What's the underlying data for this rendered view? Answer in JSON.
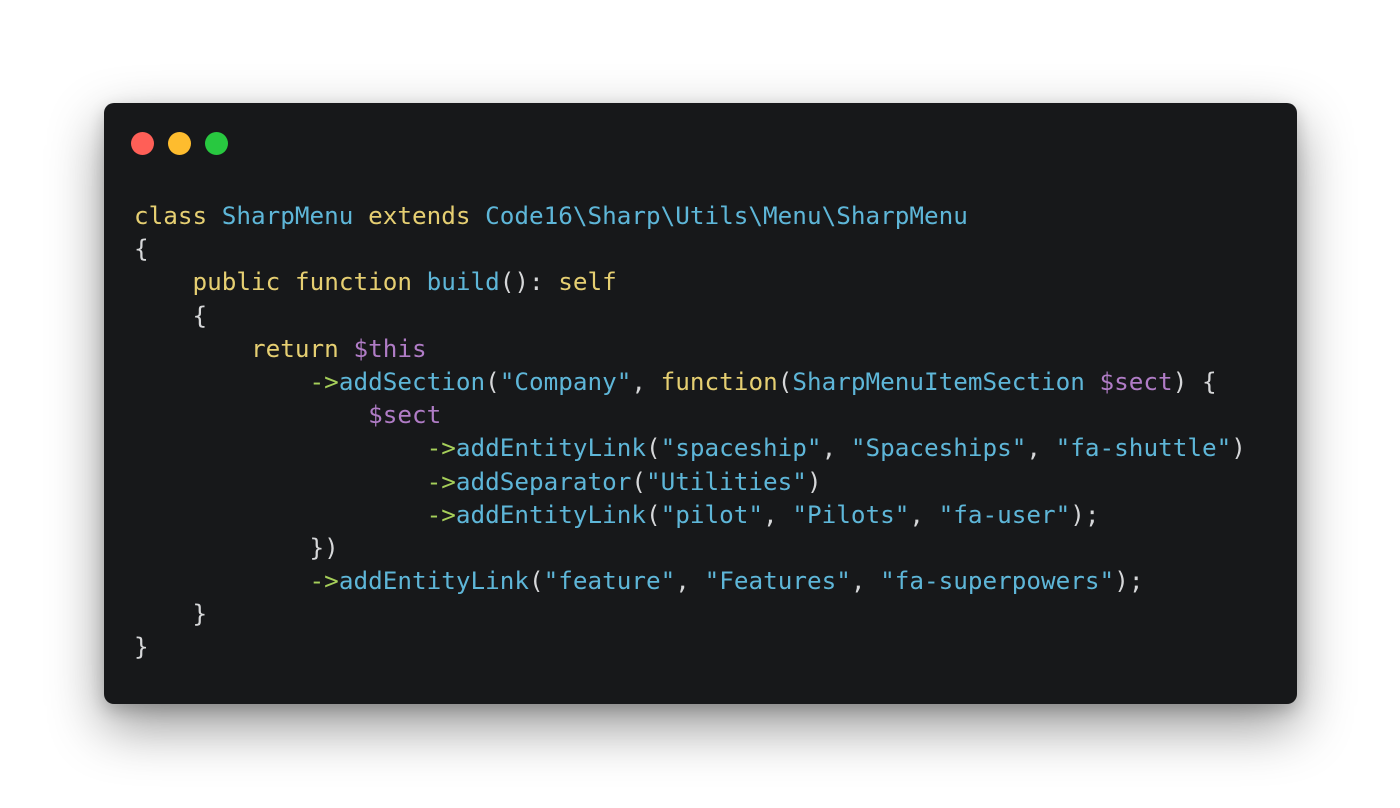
{
  "window": {
    "controls": [
      {
        "name": "close",
        "color": "#ff5f57"
      },
      {
        "name": "minimize",
        "color": "#febc2e"
      },
      {
        "name": "maximize",
        "color": "#28c840"
      }
    ]
  },
  "code": {
    "lines": [
      [
        {
          "t": "keyword",
          "v": "class"
        },
        {
          "t": "plain",
          "v": " "
        },
        {
          "t": "class",
          "v": "SharpMenu"
        },
        {
          "t": "plain",
          "v": " "
        },
        {
          "t": "keyword",
          "v": "extends"
        },
        {
          "t": "plain",
          "v": " "
        },
        {
          "t": "class",
          "v": "Code16\\Sharp\\Utils\\Menu\\SharpMenu"
        }
      ],
      [
        {
          "t": "punct",
          "v": "{"
        }
      ],
      [
        {
          "t": "plain",
          "v": "    "
        },
        {
          "t": "keyword",
          "v": "public"
        },
        {
          "t": "plain",
          "v": " "
        },
        {
          "t": "keyword",
          "v": "function"
        },
        {
          "t": "plain",
          "v": " "
        },
        {
          "t": "func",
          "v": "build"
        },
        {
          "t": "punct",
          "v": "():"
        },
        {
          "t": "plain",
          "v": " "
        },
        {
          "t": "keyword",
          "v": "self"
        }
      ],
      [
        {
          "t": "plain",
          "v": "    "
        },
        {
          "t": "punct",
          "v": "{"
        }
      ],
      [
        {
          "t": "plain",
          "v": "        "
        },
        {
          "t": "keyword",
          "v": "return"
        },
        {
          "t": "plain",
          "v": " "
        },
        {
          "t": "var",
          "v": "$this"
        }
      ],
      [
        {
          "t": "plain",
          "v": "            "
        },
        {
          "t": "arrow",
          "v": "->"
        },
        {
          "t": "func",
          "v": "addSection"
        },
        {
          "t": "punct",
          "v": "("
        },
        {
          "t": "string",
          "v": "\"Company\""
        },
        {
          "t": "punct",
          "v": ","
        },
        {
          "t": "plain",
          "v": " "
        },
        {
          "t": "keyword",
          "v": "function"
        },
        {
          "t": "punct",
          "v": "("
        },
        {
          "t": "class",
          "v": "SharpMenuItemSection"
        },
        {
          "t": "plain",
          "v": " "
        },
        {
          "t": "var",
          "v": "$sect"
        },
        {
          "t": "punct",
          "v": ")"
        },
        {
          "t": "plain",
          "v": " "
        },
        {
          "t": "punct",
          "v": "{"
        }
      ],
      [
        {
          "t": "plain",
          "v": "                "
        },
        {
          "t": "var",
          "v": "$sect"
        }
      ],
      [
        {
          "t": "plain",
          "v": "                    "
        },
        {
          "t": "arrow",
          "v": "->"
        },
        {
          "t": "func",
          "v": "addEntityLink"
        },
        {
          "t": "punct",
          "v": "("
        },
        {
          "t": "string",
          "v": "\"spaceship\""
        },
        {
          "t": "punct",
          "v": ","
        },
        {
          "t": "plain",
          "v": " "
        },
        {
          "t": "string",
          "v": "\"Spaceships\""
        },
        {
          "t": "punct",
          "v": ","
        },
        {
          "t": "plain",
          "v": " "
        },
        {
          "t": "string",
          "v": "\"fa-shuttle\""
        },
        {
          "t": "punct",
          "v": ")"
        }
      ],
      [
        {
          "t": "plain",
          "v": "                    "
        },
        {
          "t": "arrow",
          "v": "->"
        },
        {
          "t": "func",
          "v": "addSeparator"
        },
        {
          "t": "punct",
          "v": "("
        },
        {
          "t": "string",
          "v": "\"Utilities\""
        },
        {
          "t": "punct",
          "v": ")"
        }
      ],
      [
        {
          "t": "plain",
          "v": "                    "
        },
        {
          "t": "arrow",
          "v": "->"
        },
        {
          "t": "func",
          "v": "addEntityLink"
        },
        {
          "t": "punct",
          "v": "("
        },
        {
          "t": "string",
          "v": "\"pilot\""
        },
        {
          "t": "punct",
          "v": ","
        },
        {
          "t": "plain",
          "v": " "
        },
        {
          "t": "string",
          "v": "\"Pilots\""
        },
        {
          "t": "punct",
          "v": ","
        },
        {
          "t": "plain",
          "v": " "
        },
        {
          "t": "string",
          "v": "\"fa-user\""
        },
        {
          "t": "punct",
          "v": ");"
        }
      ],
      [
        {
          "t": "plain",
          "v": "            "
        },
        {
          "t": "punct",
          "v": "})"
        }
      ],
      [
        {
          "t": "plain",
          "v": "            "
        },
        {
          "t": "arrow",
          "v": "->"
        },
        {
          "t": "func",
          "v": "addEntityLink"
        },
        {
          "t": "punct",
          "v": "("
        },
        {
          "t": "string",
          "v": "\"feature\""
        },
        {
          "t": "punct",
          "v": ","
        },
        {
          "t": "plain",
          "v": " "
        },
        {
          "t": "string",
          "v": "\"Features\""
        },
        {
          "t": "punct",
          "v": ","
        },
        {
          "t": "plain",
          "v": " "
        },
        {
          "t": "string",
          "v": "\"fa-superpowers\""
        },
        {
          "t": "punct",
          "v": ");"
        }
      ],
      [
        {
          "t": "plain",
          "v": "    "
        },
        {
          "t": "punct",
          "v": "}"
        }
      ],
      [
        {
          "t": "punct",
          "v": "}"
        }
      ]
    ]
  }
}
